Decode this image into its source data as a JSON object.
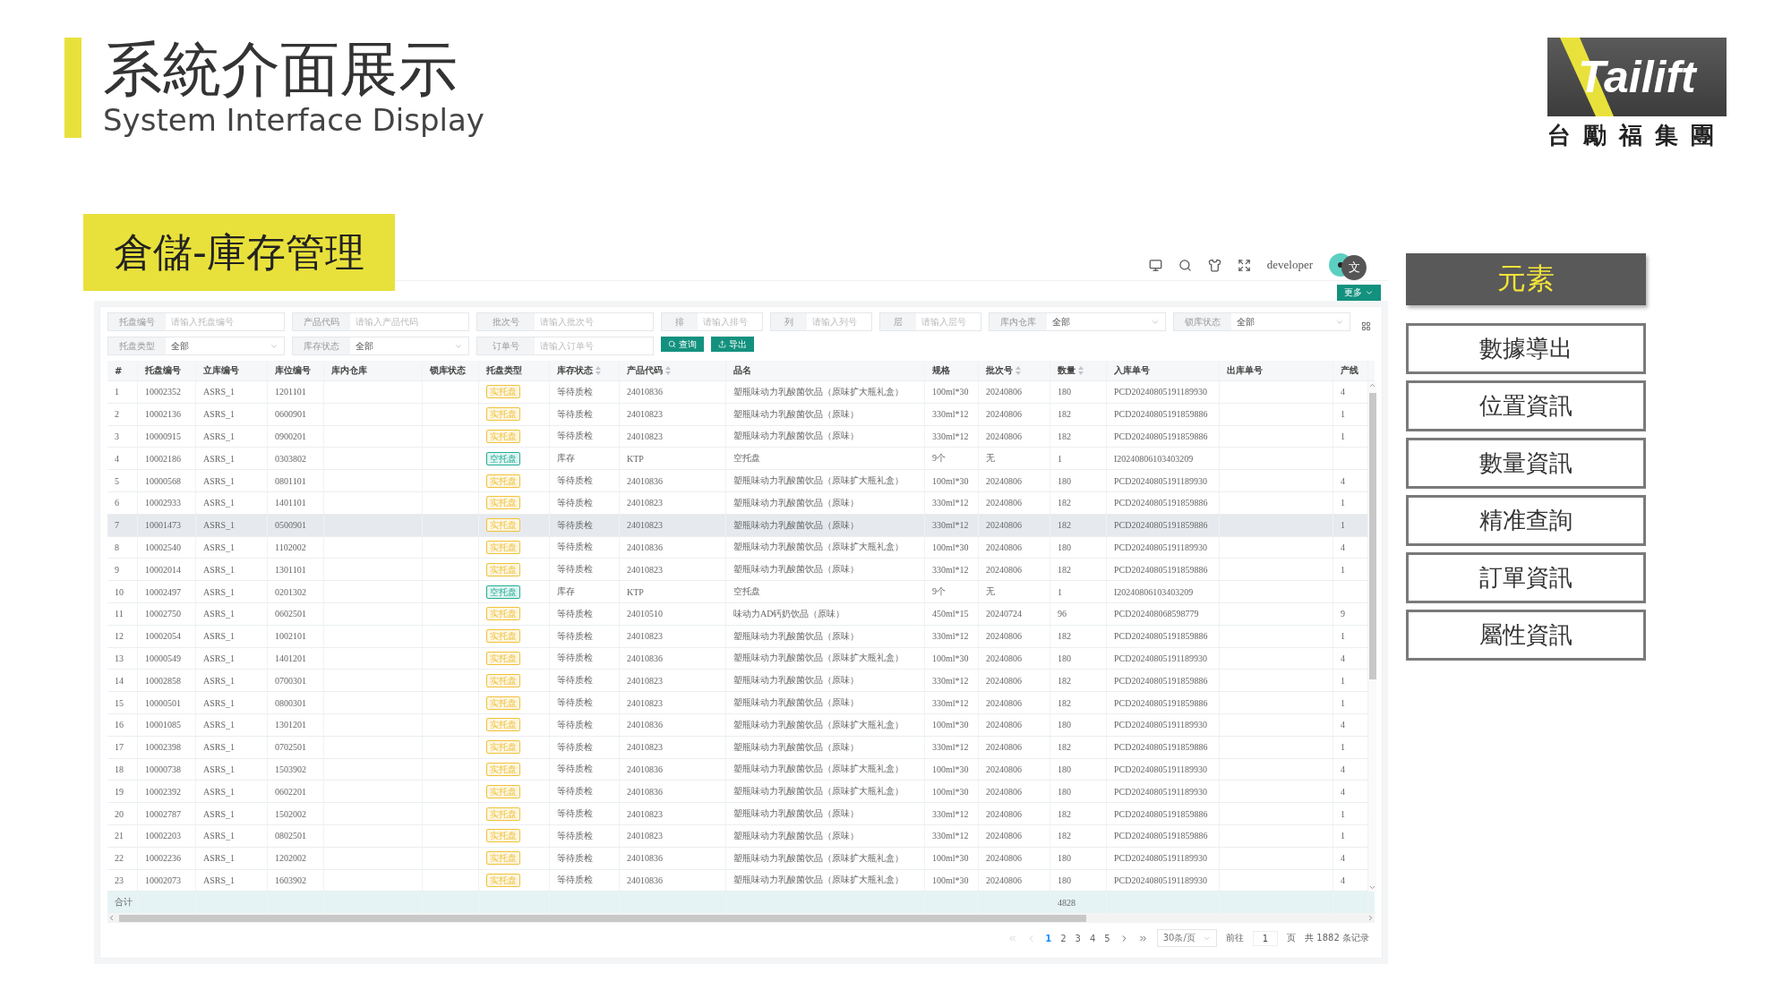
{
  "slide": {
    "title": "系統介面展示",
    "subtitle": "System Interface Display",
    "logo": {
      "wordmark": "Tailift",
      "company": "台勵福集團"
    },
    "section_label": "倉儲-庫存管理"
  },
  "topbar": {
    "user": "developer",
    "translate_badge": "文",
    "more_button": "更多"
  },
  "filters": [
    {
      "label": "托盘编号",
      "kind": "input",
      "placeholder": "请输入托盘编号"
    },
    {
      "label": "产品代码",
      "kind": "input",
      "placeholder": "请输入产品代码"
    },
    {
      "label": "批次号",
      "kind": "input",
      "placeholder": "请输入批次号"
    },
    {
      "label": "排",
      "kind": "input",
      "placeholder": "请输入排号"
    },
    {
      "label": "列",
      "kind": "input",
      "placeholder": "请输入列号"
    },
    {
      "label": "层",
      "kind": "input",
      "placeholder": "请输入层号"
    },
    {
      "label": "库内仓库",
      "kind": "select",
      "value": "全部"
    },
    {
      "label": "锁库状态",
      "kind": "select",
      "value": "全部"
    },
    {
      "label": "托盘类型",
      "kind": "select",
      "value": "全部"
    },
    {
      "label": "库存状态",
      "kind": "select",
      "value": "全部"
    },
    {
      "label": "订单号",
      "kind": "input",
      "placeholder": "请输入订单号"
    }
  ],
  "actions": [
    {
      "label": "查询",
      "kind": "search"
    },
    {
      "label": "导出",
      "kind": "export"
    }
  ],
  "table": {
    "columns": [
      {
        "label": "#",
        "sortable": false
      },
      {
        "label": "托盘编号",
        "sortable": false
      },
      {
        "label": "立库编号",
        "sortable": false
      },
      {
        "label": "库位编号",
        "sortable": false
      },
      {
        "label": "库内仓库",
        "sortable": false
      },
      {
        "label": "锁库状态",
        "sortable": false
      },
      {
        "label": "托盘类型",
        "sortable": false
      },
      {
        "label": "库存状态",
        "sortable": true
      },
      {
        "label": "产品代码",
        "sortable": true
      },
      {
        "label": "品名",
        "sortable": false
      },
      {
        "label": "规格",
        "sortable": false
      },
      {
        "label": "批次号",
        "sortable": true
      },
      {
        "label": "数量",
        "sortable": true
      },
      {
        "label": "入库单号",
        "sortable": false
      },
      {
        "label": "出库单号",
        "sortable": false
      },
      {
        "label": "产线",
        "sortable": false
      }
    ],
    "rows": [
      {
        "n": "1",
        "tray": "10002352",
        "asrs": "ASRS_1",
        "loc": "1201101",
        "type": "实托盘",
        "color": "#f0c23a",
        "status": "等待质检",
        "code": "24010836",
        "name": "塑瓶味动力乳酸菌饮品（原味扩大瓶礼盒）",
        "spec": "100ml*30",
        "batch": "20240806",
        "qty": "180",
        "inbound": "PCD20240805191189930",
        "line": "4",
        "highlighted": false
      },
      {
        "n": "2",
        "tray": "10002136",
        "asrs": "ASRS_1",
        "loc": "0600901",
        "type": "实托盘",
        "color": "#f0c23a",
        "status": "等待质检",
        "code": "24010823",
        "name": "塑瓶味动力乳酸菌饮品（原味）",
        "spec": "330ml*12",
        "batch": "20240806",
        "qty": "182",
        "inbound": "PCD20240805191859886",
        "line": "1",
        "highlighted": false
      },
      {
        "n": "3",
        "tray": "10000915",
        "asrs": "ASRS_1",
        "loc": "0900201",
        "type": "实托盘",
        "color": "#f0c23a",
        "status": "等待质检",
        "code": "24010823",
        "name": "塑瓶味动力乳酸菌饮品（原味）",
        "spec": "330ml*12",
        "batch": "20240806",
        "qty": "182",
        "inbound": "PCD20240805191859886",
        "line": "1",
        "highlighted": false
      },
      {
        "n": "4",
        "tray": "10002186",
        "asrs": "ASRS_1",
        "loc": "0303802",
        "type": "空托盘",
        "color": "#25ad98",
        "status": "库存",
        "code": "KTP",
        "name": "空托盘",
        "spec": "9个",
        "batch": "无",
        "qty": "1",
        "inbound": "I20240806103403209",
        "highlighted": false
      },
      {
        "n": "5",
        "tray": "10000568",
        "asrs": "ASRS_1",
        "loc": "0801101",
        "type": "实托盘",
        "color": "#f0c23a",
        "status": "等待质检",
        "code": "24010836",
        "name": "塑瓶味动力乳酸菌饮品（原味扩大瓶礼盒）",
        "spec": "100ml*30",
        "batch": "20240806",
        "qty": "180",
        "inbound": "PCD20240805191189930",
        "line": "4",
        "highlighted": false
      },
      {
        "n": "6",
        "tray": "10002933",
        "asrs": "ASRS_1",
        "loc": "1401101",
        "type": "实托盘",
        "color": "#f0c23a",
        "status": "等待质检",
        "code": "24010823",
        "name": "塑瓶味动力乳酸菌饮品（原味）",
        "spec": "330ml*12",
        "batch": "20240806",
        "qty": "182",
        "inbound": "PCD20240805191859886",
        "line": "1",
        "highlighted": false
      },
      {
        "n": "7",
        "tray": "10001473",
        "asrs": "ASRS_1",
        "loc": "0500901",
        "type": "实托盘",
        "color": "#f0c23a",
        "status": "等待质检",
        "code": "24010823",
        "name": "塑瓶味动力乳酸菌饮品（原味）",
        "spec": "330ml*12",
        "batch": "20240806",
        "qty": "182",
        "inbound": "PCD20240805191859886",
        "line": "1",
        "highlighted": true
      },
      {
        "n": "8",
        "tray": "10002540",
        "asrs": "ASRS_1",
        "loc": "1102002",
        "type": "实托盘",
        "color": "#f0c23a",
        "status": "等待质检",
        "code": "24010836",
        "name": "塑瓶味动力乳酸菌饮品（原味扩大瓶礼盒）",
        "spec": "100ml*30",
        "batch": "20240806",
        "qty": "180",
        "inbound": "PCD20240805191189930",
        "line": "4",
        "highlighted": false
      },
      {
        "n": "9",
        "tray": "10002014",
        "asrs": "ASRS_1",
        "loc": "1301101",
        "type": "实托盘",
        "color": "#f0c23a",
        "status": "等待质检",
        "code": "24010823",
        "name": "塑瓶味动力乳酸菌饮品（原味）",
        "spec": "330ml*12",
        "batch": "20240806",
        "qty": "182",
        "inbound": "PCD20240805191859886",
        "line": "1",
        "highlighted": false
      },
      {
        "n": "10",
        "tray": "10002497",
        "asrs": "ASRS_1",
        "loc": "0201302",
        "type": "空托盘",
        "color": "#25ad98",
        "status": "库存",
        "code": "KTP",
        "name": "空托盘",
        "spec": "9个",
        "batch": "无",
        "qty": "1",
        "inbound": "I20240806103403209",
        "highlighted": false
      },
      {
        "n": "11",
        "tray": "10002750",
        "asrs": "ASRS_1",
        "loc": "0602501",
        "type": "实托盘",
        "color": "#f0c23a",
        "status": "等待质检",
        "code": "24010510",
        "name": "味动力AD钙奶饮品（原味）",
        "spec": "450ml*15",
        "batch": "20240724",
        "qty": "96",
        "inbound": "PCD202408068598779",
        "line": "9",
        "highlighted": false
      },
      {
        "n": "12",
        "tray": "10002054",
        "asrs": "ASRS_1",
        "loc": "1002101",
        "type": "实托盘",
        "color": "#f0c23a",
        "status": "等待质检",
        "code": "24010823",
        "name": "塑瓶味动力乳酸菌饮品（原味）",
        "spec": "330ml*12",
        "batch": "20240806",
        "qty": "182",
        "inbound": "PCD20240805191859886",
        "line": "1",
        "highlighted": false
      },
      {
        "n": "13",
        "tray": "10000549",
        "asrs": "ASRS_1",
        "loc": "1401201",
        "type": "实托盘",
        "color": "#f0c23a",
        "status": "等待质检",
        "code": "24010836",
        "name": "塑瓶味动力乳酸菌饮品（原味扩大瓶礼盒）",
        "spec": "100ml*30",
        "batch": "20240806",
        "qty": "180",
        "inbound": "PCD20240805191189930",
        "line": "4",
        "highlighted": false
      },
      {
        "n": "14",
        "tray": "10002858",
        "asrs": "ASRS_1",
        "loc": "0700301",
        "type": "实托盘",
        "color": "#f0c23a",
        "status": "等待质检",
        "code": "24010823",
        "name": "塑瓶味动力乳酸菌饮品（原味）",
        "spec": "330ml*12",
        "batch": "20240806",
        "qty": "182",
        "inbound": "PCD20240805191859886",
        "line": "1",
        "highlighted": false
      },
      {
        "n": "15",
        "tray": "10000501",
        "asrs": "ASRS_1",
        "loc": "0800301",
        "type": "实托盘",
        "color": "#f0c23a",
        "status": "等待质检",
        "code": "24010823",
        "name": "塑瓶味动力乳酸菌饮品（原味）",
        "spec": "330ml*12",
        "batch": "20240806",
        "qty": "182",
        "inbound": "PCD20240805191859886",
        "line": "1",
        "highlighted": false
      },
      {
        "n": "16",
        "tray": "10001085",
        "asrs": "ASRS_1",
        "loc": "1301201",
        "type": "实托盘",
        "color": "#f0c23a",
        "status": "等待质检",
        "code": "24010836",
        "name": "塑瓶味动力乳酸菌饮品（原味扩大瓶礼盒）",
        "spec": "100ml*30",
        "batch": "20240806",
        "qty": "180",
        "inbound": "PCD20240805191189930",
        "line": "4",
        "highlighted": false
      },
      {
        "n": "17",
        "tray": "10002398",
        "asrs": "ASRS_1",
        "loc": "0702501",
        "type": "实托盘",
        "color": "#f0c23a",
        "status": "等待质检",
        "code": "24010823",
        "name": "塑瓶味动力乳酸菌饮品（原味）",
        "spec": "330ml*12",
        "batch": "20240806",
        "qty": "182",
        "inbound": "PCD20240805191859886",
        "line": "1",
        "highlighted": false
      },
      {
        "n": "18",
        "tray": "10000738",
        "asrs": "ASRS_1",
        "loc": "1503902",
        "type": "实托盘",
        "color": "#f0c23a",
        "status": "等待质检",
        "code": "24010836",
        "name": "塑瓶味动力乳酸菌饮品（原味扩大瓶礼盒）",
        "spec": "100ml*30",
        "batch": "20240806",
        "qty": "180",
        "inbound": "PCD20240805191189930",
        "line": "4",
        "highlighted": false
      },
      {
        "n": "19",
        "tray": "10002392",
        "asrs": "ASRS_1",
        "loc": "0602201",
        "type": "实托盘",
        "color": "#f0c23a",
        "status": "等待质检",
        "code": "24010836",
        "name": "塑瓶味动力乳酸菌饮品（原味扩大瓶礼盒）",
        "spec": "100ml*30",
        "batch": "20240806",
        "qty": "180",
        "inbound": "PCD20240805191189930",
        "line": "4",
        "highlighted": false
      },
      {
        "n": "20",
        "tray": "10002787",
        "asrs": "ASRS_1",
        "loc": "1502002",
        "type": "实托盘",
        "color": "#f0c23a",
        "status": "等待质检",
        "code": "24010823",
        "name": "塑瓶味动力乳酸菌饮品（原味）",
        "spec": "330ml*12",
        "batch": "20240806",
        "qty": "182",
        "inbound": "PCD20240805191859886",
        "line": "1",
        "highlighted": false
      },
      {
        "n": "21",
        "tray": "10002203",
        "asrs": "ASRS_1",
        "loc": "0802501",
        "type": "实托盘",
        "color": "#f0c23a",
        "status": "等待质检",
        "code": "24010823",
        "name": "塑瓶味动力乳酸菌饮品（原味）",
        "spec": "330ml*12",
        "batch": "20240806",
        "qty": "182",
        "inbound": "PCD20240805191859886",
        "line": "1",
        "highlighted": false
      },
      {
        "n": "22",
        "tray": "10002236",
        "asrs": "ASRS_1",
        "loc": "1202002",
        "type": "实托盘",
        "color": "#f0c23a",
        "status": "等待质检",
        "code": "24010836",
        "name": "塑瓶味动力乳酸菌饮品（原味扩大瓶礼盒）",
        "spec": "100ml*30",
        "batch": "20240806",
        "qty": "180",
        "inbound": "PCD20240805191189930",
        "line": "4",
        "highlighted": false
      },
      {
        "n": "23",
        "tray": "10002073",
        "asrs": "ASRS_1",
        "loc": "1603902",
        "type": "实托盘",
        "color": "#f0c23a",
        "status": "等待质检",
        "code": "24010836",
        "name": "塑瓶味动力乳酸菌饮品（原味扩大瓶礼盒）",
        "spec": "100ml*30",
        "batch": "20240806",
        "qty": "180",
        "inbound": "PCD20240805191189930",
        "line": "4",
        "highlighted": false
      }
    ],
    "total": {
      "label": "合计",
      "qty": "4828"
    }
  },
  "pagination": {
    "pages": [
      {
        "label": "1",
        "selected": true
      },
      {
        "label": "2",
        "selected": false
      },
      {
        "label": "3",
        "selected": false
      },
      {
        "label": "4",
        "selected": false
      },
      {
        "label": "5",
        "selected": false
      }
    ],
    "page_size": "30条/页",
    "goto_label": "前往",
    "goto_value": "1",
    "goto_unit": "页",
    "total": "共 1882 条记录"
  },
  "side_panel": {
    "title": "元素",
    "buttons": [
      "數據導出",
      "位置資訊",
      "數量資訊",
      "精准查詢",
      "訂單資訊",
      "屬性資訊"
    ]
  }
}
